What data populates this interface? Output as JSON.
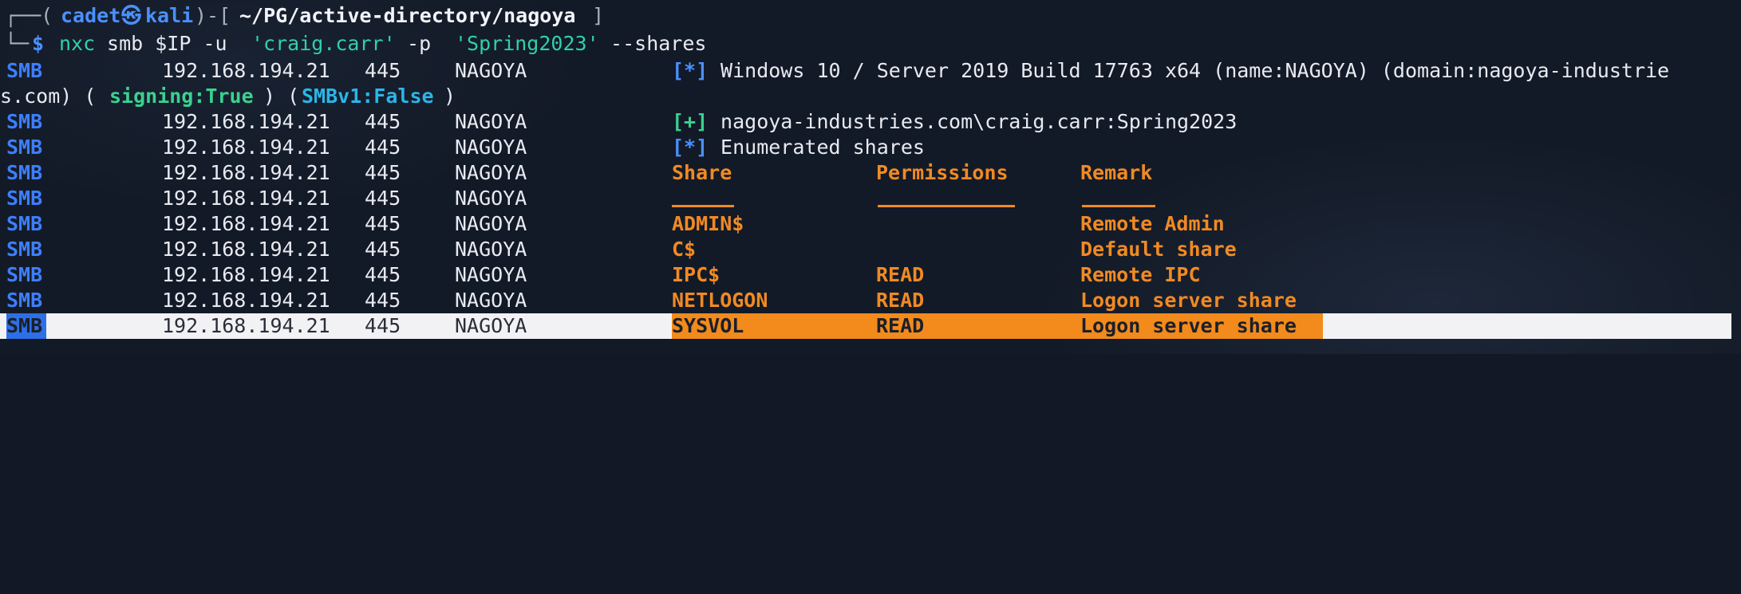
{
  "prompt": {
    "corner_top": "┌──(",
    "user": "cadet",
    "at_symbol": "㉿",
    "host": "kali",
    "sep": ")-[",
    "path": "~/PG/active-directory/nagoya",
    "close": "]",
    "corner_bottom": "└─",
    "dollar": "$",
    "command": "nxc",
    "args": " smb $IP -u ",
    "user_arg": "'craig.carr'",
    "pw_flag": " -p ",
    "pw_arg": "'Spring2023'",
    "shares_flag": " --shares"
  },
  "info_line": {
    "proto": "SMB",
    "ip": "192.168.194.21",
    "port": "445",
    "host": "NAGOYA",
    "marker": "[*]",
    "text": " Windows 10 / Server 2019 Build 17763 x64 (name:NAGOYA) (domain:nagoya-industrie",
    "wrap_start": "s.com) (",
    "signing": "signing:True",
    "mid": ") (",
    "smbv1": "SMBv1:False",
    "wrap_end": ")"
  },
  "auth_line": {
    "marker": "[+]",
    "text": " nagoya-industries.com\\craig.carr:Spring2023"
  },
  "enum_line": {
    "marker": "[*]",
    "text": " Enumerated shares"
  },
  "table_headers": {
    "share": "Share",
    "permissions": "Permissions",
    "remark": "Remark"
  },
  "shares": [
    {
      "share": "ADMIN$",
      "perm": "",
      "remark": "Remote Admin"
    },
    {
      "share": "C$",
      "perm": "",
      "remark": "Default share"
    },
    {
      "share": "IPC$",
      "perm": "READ",
      "remark": "Remote IPC"
    },
    {
      "share": "NETLOGON",
      "perm": "READ",
      "remark": "Logon server share"
    },
    {
      "share": "SYSVOL",
      "perm": "READ",
      "remark": "Logon server share"
    }
  ],
  "row": {
    "proto": "SMB",
    "ip": "192.168.194.21",
    "port": "445",
    "host": "NAGOYA"
  },
  "colors": {
    "orange": "#f08a24",
    "blue": "#3d7fff",
    "green": "#3ad28f",
    "background": "#131a27"
  }
}
